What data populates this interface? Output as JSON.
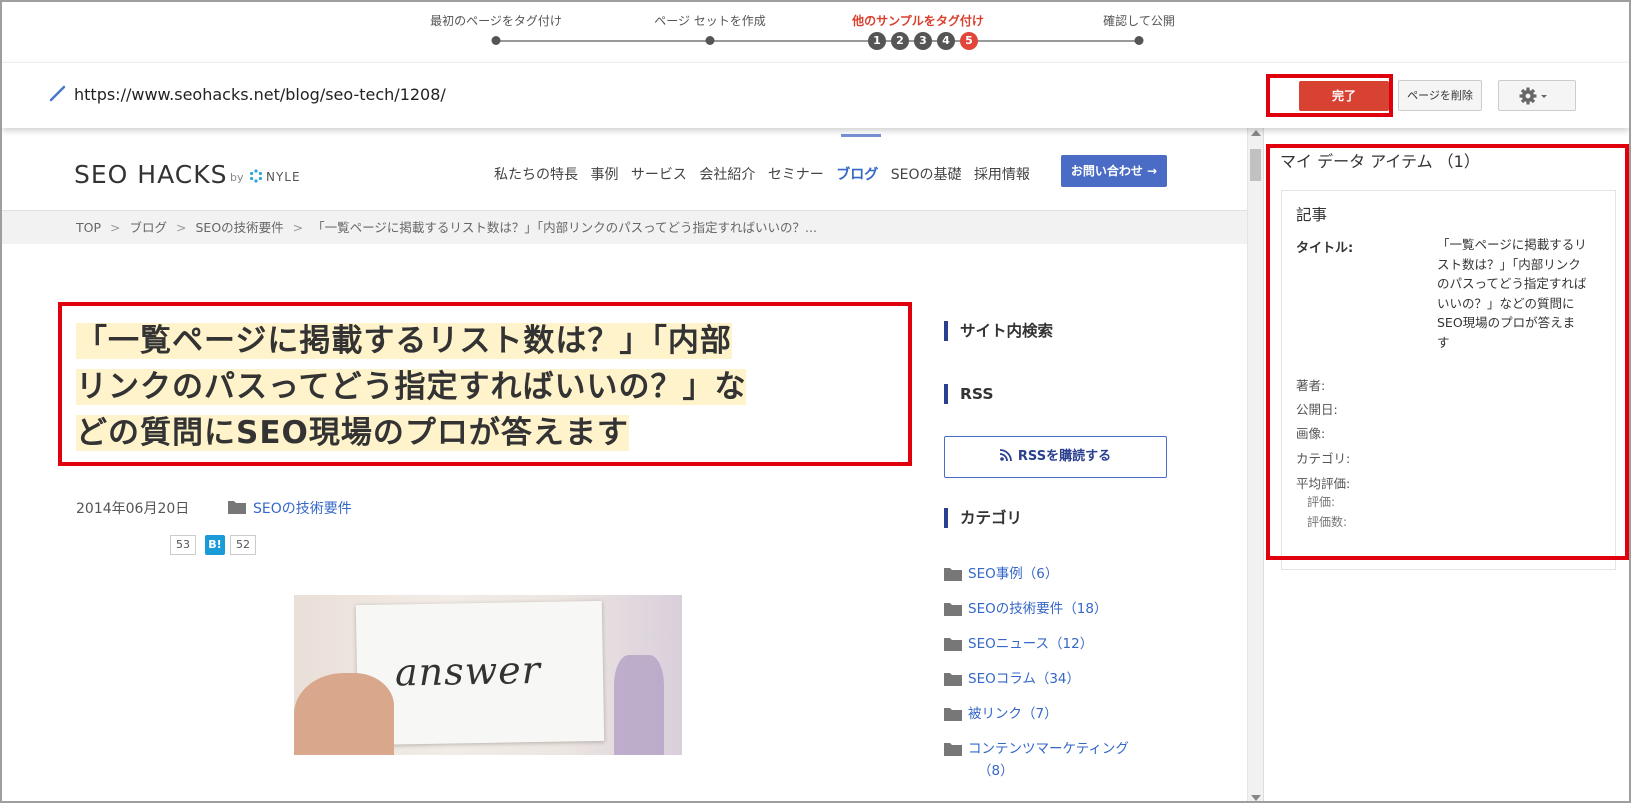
{
  "stepper": {
    "steps": [
      {
        "label": "最初のページをタグ付け"
      },
      {
        "label": "ページ セットを作成"
      },
      {
        "label": "他のサンプルをタグ付け"
      },
      {
        "label": "確認して公開"
      }
    ],
    "numbers": [
      "1",
      "2",
      "3",
      "4",
      "5"
    ]
  },
  "urlbar": {
    "url": "https://www.seohacks.net/blog/seo-tech/1208/",
    "done_label": "完了",
    "delete_page_label": "ページを削除"
  },
  "site": {
    "logo": "SEO HACKS",
    "logo_by": "by",
    "partner": "NYLE",
    "nav": [
      "私たちの特長",
      "事例",
      "サービス",
      "会社紹介",
      "セミナー",
      "ブログ",
      "SEOの基礎",
      "採用情報"
    ],
    "contact_label": "お問い合わせ →",
    "breadcrumb": [
      "TOP",
      "ブログ",
      "SEOの技術要件",
      "「一覧ページに掲載するリスト数は？」「内部リンクのパスってどう指定すればいいの？..."
    ],
    "article": {
      "title_lines": [
        "「一覧ページに掲載するリスト数は？」「内部",
        "リンクのパスってどう指定すればいいの？」な",
        "どの質問にSEO現場のプロが答えます"
      ],
      "date": "2014年06月20日",
      "category": "SEOの技術要件",
      "share_count": "53",
      "hatena_label": "B!",
      "hatena_count": "52",
      "image_text": "answer"
    },
    "sidebar": {
      "search_heading": "サイト内検索",
      "rss_heading": "RSS",
      "rss_button": "RSSを購読する",
      "category_heading": "カテゴリ",
      "categories": [
        "SEO事例（6）",
        "SEOの技術要件（18）",
        "SEOニュース（12）",
        "SEOコラム（34）",
        "被リンク（7）",
        "コンテンツマーケティング"
      ],
      "last_category_count": "（8）"
    }
  },
  "panel": {
    "title": "マイ データ アイテム （1）",
    "card_type": "記事",
    "fields": {
      "title_label": "タイトル:",
      "title_value": "「一覧ページに掲載するリスト数は？」「内部リンクのパスってどう指定すればいいの？」などの質問にSEO現場のプロが答えます",
      "author": "著者:",
      "published": "公開日:",
      "image": "画像:",
      "category": "カテゴリ:",
      "avg_rating": "平均評価:",
      "rating": "評価:",
      "rating_count": "評価数:"
    }
  },
  "colors": {
    "accent_red": "#e0463a",
    "highlight_red": "#e0000d",
    "link_blue": "#3567c8",
    "nav_blue": "#4a6cc5"
  }
}
